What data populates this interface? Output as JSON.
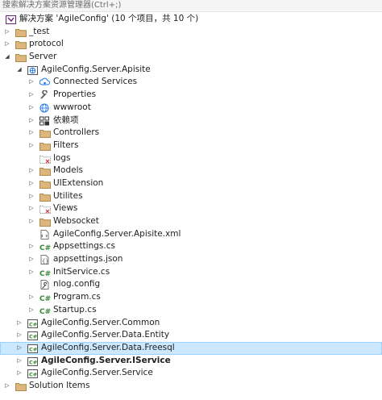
{
  "search": {
    "placeholder": "搜索解决方案资源管理器(Ctrl+;)"
  },
  "solution": {
    "label": "解决方案 'AgileConfig' (10 个项目，共 10 个)"
  },
  "tree": [
    {
      "label": "_test",
      "icon": "folder-icon",
      "level": 0,
      "arrow": "▷"
    },
    {
      "label": "protocol",
      "icon": "folder-icon",
      "level": 0,
      "arrow": "▷"
    },
    {
      "label": "Server",
      "icon": "folder-icon",
      "level": 0,
      "arrow": "◢"
    },
    {
      "label": "AgileConfig.Server.Apisite",
      "icon": "web-project-icon",
      "level": 1,
      "arrow": "◢"
    },
    {
      "label": "Connected Services",
      "icon": "connected-services-icon",
      "level": 2,
      "arrow": "▷"
    },
    {
      "label": "Properties",
      "icon": "wrench-icon",
      "level": 2,
      "arrow": "▷"
    },
    {
      "label": "wwwroot",
      "icon": "globe-icon",
      "level": 2,
      "arrow": "▷"
    },
    {
      "label": "依赖项",
      "icon": "dependencies-icon",
      "level": 2,
      "arrow": "▷"
    },
    {
      "label": "Controllers",
      "icon": "folder-icon",
      "level": 2,
      "arrow": "▷"
    },
    {
      "label": "Filters",
      "icon": "folder-icon",
      "level": 2,
      "arrow": "▷"
    },
    {
      "label": "logs",
      "icon": "excluded-folder-icon",
      "level": 2,
      "arrow": ""
    },
    {
      "label": "Models",
      "icon": "folder-icon",
      "level": 2,
      "arrow": "▷"
    },
    {
      "label": "UIExtension",
      "icon": "folder-icon",
      "level": 2,
      "arrow": "▷"
    },
    {
      "label": "Utilites",
      "icon": "folder-icon",
      "level": 2,
      "arrow": "▷"
    },
    {
      "label": "Views",
      "icon": "excluded-folder-icon",
      "level": 2,
      "arrow": "▷"
    },
    {
      "label": "Websocket",
      "icon": "folder-icon",
      "level": 2,
      "arrow": "▷"
    },
    {
      "label": "AgileConfig.Server.Apisite.xml",
      "icon": "xml-file-icon",
      "level": 2,
      "arrow": ""
    },
    {
      "label": "Appsettings.cs",
      "icon": "csharp-file-icon",
      "level": 2,
      "arrow": "▷"
    },
    {
      "label": "appsettings.json",
      "icon": "json-file-icon",
      "level": 2,
      "arrow": "▷"
    },
    {
      "label": "InitService.cs",
      "icon": "csharp-file-icon",
      "level": 2,
      "arrow": "▷"
    },
    {
      "label": "nlog.config",
      "icon": "config-file-icon",
      "level": 2,
      "arrow": ""
    },
    {
      "label": "Program.cs",
      "icon": "csharp-file-icon",
      "level": 2,
      "arrow": "▷"
    },
    {
      "label": "Startup.cs",
      "icon": "csharp-file-icon",
      "level": 2,
      "arrow": "▷"
    },
    {
      "label": "AgileConfig.Server.Common",
      "icon": "csharp-project-icon",
      "level": 1,
      "arrow": "▷"
    },
    {
      "label": "AgileConfig.Server.Data.Entity",
      "icon": "csharp-project-icon",
      "level": 1,
      "arrow": "▷"
    },
    {
      "label": "AgileConfig.Server.Data.Freesql",
      "icon": "csharp-project-icon",
      "level": 1,
      "arrow": "▷",
      "selected": true
    },
    {
      "label": "AgileConfig.Server.IService",
      "icon": "csharp-project-icon",
      "level": 1,
      "arrow": "▷",
      "bold": true
    },
    {
      "label": "AgileConfig.Server.Service",
      "icon": "csharp-project-icon",
      "level": 1,
      "arrow": "▷"
    },
    {
      "label": "Solution Items",
      "icon": "folder-icon",
      "level": 0,
      "arrow": "▷"
    }
  ],
  "colors": {
    "selection": "#cce8ff",
    "folder": "#dcb67a",
    "csharp": "#368832"
  }
}
